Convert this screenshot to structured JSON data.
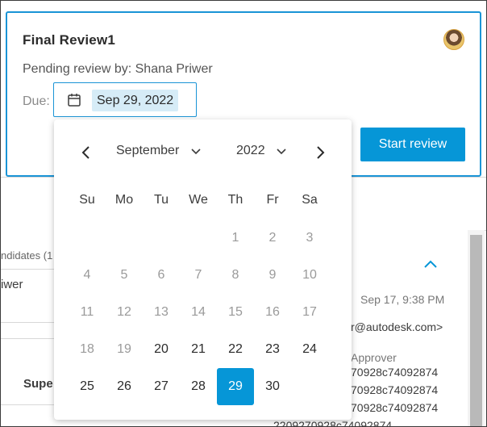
{
  "card": {
    "title": "Final Review1",
    "pending": "Pending review by: Shana Priwer",
    "due_label": "Due:",
    "due_value": "Sep 29, 2022",
    "start_button": "Start review"
  },
  "picker": {
    "month": "September",
    "year": "2022",
    "weekdays": [
      "Su",
      "Mo",
      "Tu",
      "We",
      "Th",
      "Fr",
      "Sa"
    ],
    "weeks": [
      [
        null,
        null,
        null,
        null,
        {
          "d": "1",
          "state": "muted"
        },
        {
          "d": "2",
          "state": "muted"
        },
        {
          "d": "3",
          "state": "muted"
        }
      ],
      [
        {
          "d": "4",
          "state": "muted"
        },
        {
          "d": "5",
          "state": "muted"
        },
        {
          "d": "6",
          "state": "muted"
        },
        {
          "d": "7",
          "state": "muted"
        },
        {
          "d": "8",
          "state": "muted"
        },
        {
          "d": "9",
          "state": "muted"
        },
        {
          "d": "10",
          "state": "muted"
        }
      ],
      [
        {
          "d": "11",
          "state": "muted"
        },
        {
          "d": "12",
          "state": "muted"
        },
        {
          "d": "13",
          "state": "muted"
        },
        {
          "d": "14",
          "state": "muted"
        },
        {
          "d": "15",
          "state": "muted"
        },
        {
          "d": "16",
          "state": "muted"
        },
        {
          "d": "17",
          "state": "muted"
        }
      ],
      [
        {
          "d": "18",
          "state": "muted"
        },
        {
          "d": "19",
          "state": "muted"
        },
        {
          "d": "20",
          "state": "active"
        },
        {
          "d": "21",
          "state": "active"
        },
        {
          "d": "22",
          "state": "active"
        },
        {
          "d": "23",
          "state": "active"
        },
        {
          "d": "24",
          "state": "active"
        }
      ],
      [
        {
          "d": "25",
          "state": "active"
        },
        {
          "d": "26",
          "state": "active"
        },
        {
          "d": "27",
          "state": "active"
        },
        {
          "d": "28",
          "state": "active"
        },
        {
          "d": "29",
          "state": "selected"
        },
        {
          "d": "30",
          "state": "active"
        },
        null
      ]
    ]
  },
  "background": {
    "candidates_fragment": "ndidates (1",
    "name_fragment": "iwer",
    "super_fragment": "Supe",
    "timestamp": "Sep 17, 9:38 PM",
    "email_fragment": "r@autodesk.com>",
    "role": "Approver",
    "hash_lines": [
      "70928c74092874",
      "70928c74092874",
      "70928c74092874",
      "2209270928c74092874"
    ]
  },
  "colors": {
    "accent": "#0696d7",
    "card_border": "#1a94d6",
    "chip_bg": "#d6ecf7"
  },
  "icons": [
    "calendar-icon",
    "chevron-left-icon",
    "chevron-right-icon",
    "chevron-down-icon",
    "chevron-up-icon",
    "avatar"
  ]
}
